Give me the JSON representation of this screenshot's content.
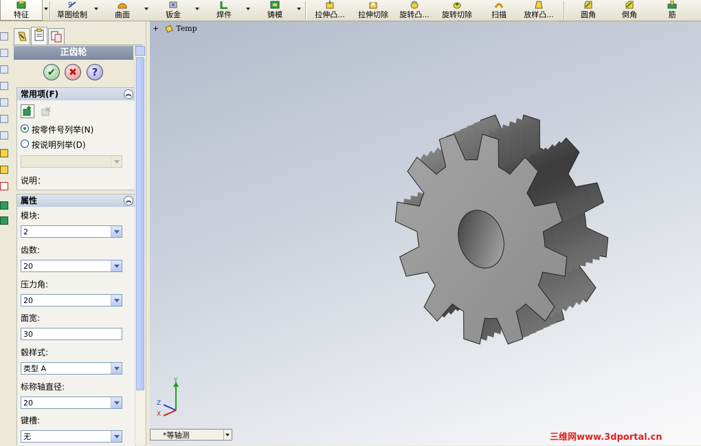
{
  "toolbar": {
    "items": [
      {
        "label": "特征",
        "icon": "feature-icon"
      },
      {
        "label": "草图绘制",
        "icon": "sketch-icon"
      },
      {
        "label": "曲面",
        "icon": "surface-icon"
      },
      {
        "label": "钣金",
        "icon": "sheet-metal-icon"
      },
      {
        "label": "焊件",
        "icon": "weldment-icon"
      },
      {
        "label": "铸模",
        "icon": "mold-icon"
      },
      {
        "label": "拉伸凸...",
        "icon": "extrude-boss-icon"
      },
      {
        "label": "拉伸切除",
        "icon": "extrude-cut-icon"
      },
      {
        "label": "旋转凸...",
        "icon": "revolve-boss-icon"
      },
      {
        "label": "旋转切除",
        "icon": "revolve-cut-icon"
      },
      {
        "label": "扫描",
        "icon": "sweep-icon"
      },
      {
        "label": "放样凸...",
        "icon": "loft-icon"
      },
      {
        "label": "圆角",
        "icon": "fillet-icon"
      },
      {
        "label": "倒角",
        "icon": "chamfer-icon"
      },
      {
        "label": "筋",
        "icon": "rib-icon"
      }
    ]
  },
  "panel": {
    "title": "正齿轮",
    "ok_icon": "check-icon",
    "cancel_icon": "cross-icon",
    "help_icon": "question-icon",
    "favorites": {
      "header": "常用项(F)",
      "radio_part_number": "按零件号列举(N)",
      "radio_description": "按说明列举(D)",
      "description_label": "说明："
    },
    "properties": {
      "header": "属性",
      "module_label": "模块:",
      "module_value": "2",
      "teeth_label": "齿数:",
      "teeth_value": "20",
      "pressure_angle_label": "压力角:",
      "pressure_angle_value": "20",
      "face_width_label": "面宽:",
      "face_width_value": "30",
      "hub_style_label": "毂样式:",
      "hub_style_value": "类型 A",
      "shaft_dia_label": "标称轴直径:",
      "shaft_dia_value": "20",
      "keyway_label": "键槽:",
      "keyway_value": "无"
    }
  },
  "viewport": {
    "tree_root": "Temp",
    "tree_expand": "+",
    "view_name": "*等轴测",
    "watermark": "三维网www.3dportal.cn",
    "triad": {
      "x": "X",
      "y": "Y",
      "z": "Z"
    }
  }
}
